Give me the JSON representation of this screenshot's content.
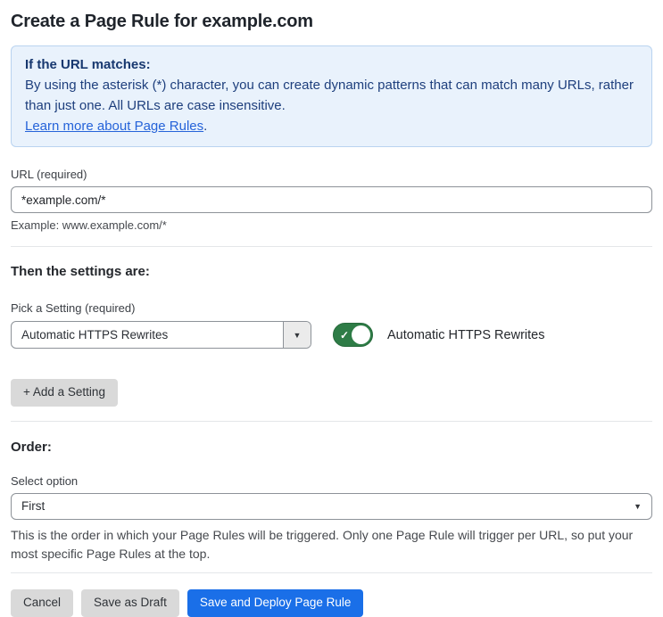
{
  "page": {
    "title": "Create a Page Rule for example.com"
  },
  "info_box": {
    "heading": "If the URL matches:",
    "body": "By using the asterisk (*) character, you can create dynamic patterns that can match many URLs, rather than just one. All URLs are case insensitive.",
    "link_label": "Learn more about Page Rules",
    "link_suffix": "."
  },
  "url_field": {
    "label": "URL (required)",
    "value": "*example.com/*",
    "helper": "Example: www.example.com/*"
  },
  "settings_section": {
    "heading": "Then the settings are:",
    "picker_label": "Pick a Setting (required)",
    "picker_value": "Automatic HTTPS Rewrites",
    "toggle_state": "on",
    "toggle_label": "Automatic HTTPS Rewrites",
    "add_button_label": "+ Add a Setting"
  },
  "order_section": {
    "heading": "Order:",
    "select_label": "Select option",
    "select_value": "First",
    "helper": "This is the order in which your Page Rules will be triggered. Only one Page Rule will trigger per URL, so put your most specific Page Rules at the top."
  },
  "actions": {
    "cancel_label": "Cancel",
    "save_draft_label": "Save as Draft",
    "save_deploy_label": "Save and Deploy Page Rule"
  },
  "icons": {
    "chevron_down": "▼",
    "check": "✓"
  },
  "colors": {
    "accent_blue": "#1a6fe8",
    "info_box_bg": "#e9f2fc",
    "info_box_border": "#b9d3f0",
    "info_text": "#1e3f7d",
    "link_blue": "#2563d9",
    "toggle_green": "#2e7c46",
    "button_gray": "#d9d9d9"
  }
}
